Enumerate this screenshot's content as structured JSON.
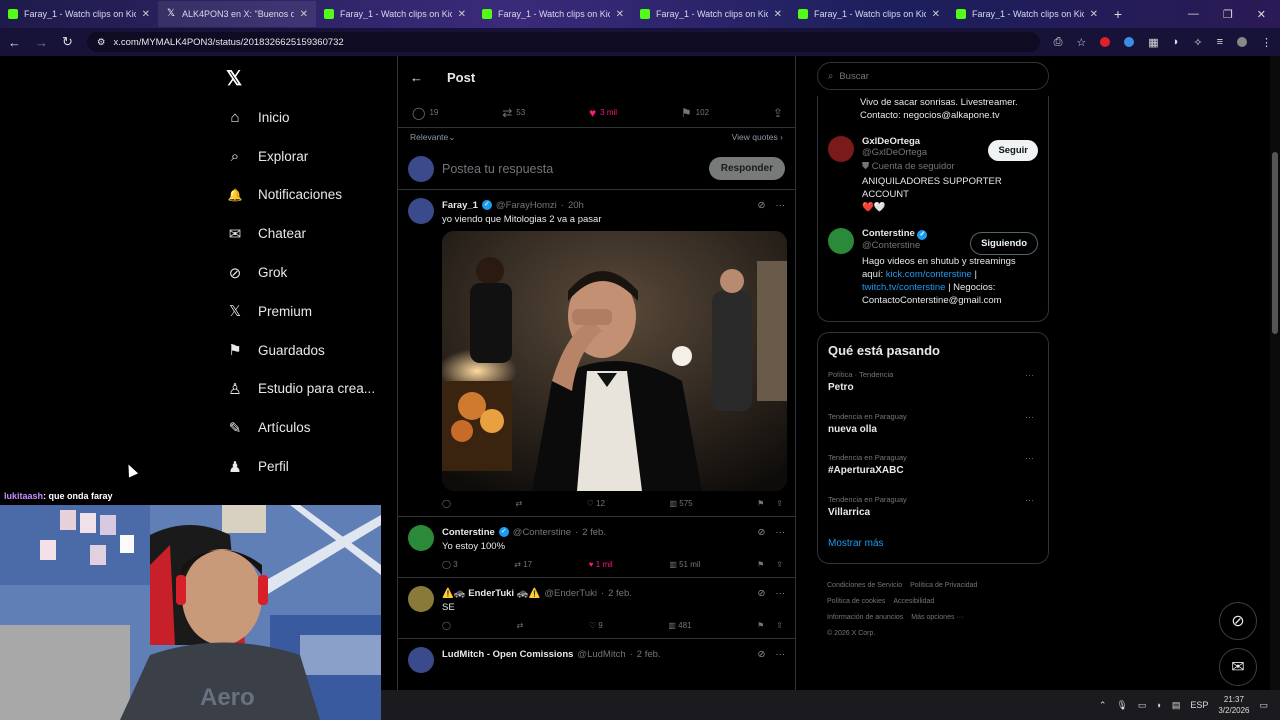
{
  "browser": {
    "tabs": [
      {
        "title": "Faray_1 - Watch clips on Kick",
        "favicon": "kick-icon"
      },
      {
        "title": "ALK4PON3 en X: \"Buenos d",
        "favicon": "x-icon"
      },
      {
        "title": "Faray_1 - Watch clips on Kick",
        "favicon": "kick-icon"
      },
      {
        "title": "Faray_1 - Watch clips on Kick",
        "favicon": "kick-icon"
      },
      {
        "title": "Faray_1 - Watch clips on Kick",
        "favicon": "kick-icon"
      },
      {
        "title": "Faray_1 - Watch clips on Kick",
        "favicon": "kick-icon"
      },
      {
        "title": "Faray_1 - Watch clips on Kick",
        "favicon": "kick-icon"
      }
    ],
    "url": "x.com/MYMALK4PON3/status/2018326625159360732"
  },
  "sidebar": {
    "items": [
      {
        "label": "Inicio",
        "icon": "⌂"
      },
      {
        "label": "Explorar",
        "icon": "⌕"
      },
      {
        "label": "Notificaciones",
        "icon": "🔔"
      },
      {
        "label": "Chatear",
        "icon": "✉"
      },
      {
        "label": "Grok",
        "icon": "⊘"
      },
      {
        "label": "Premium",
        "icon": "𝕏"
      },
      {
        "label": "Guardados",
        "icon": "⚑"
      },
      {
        "label": "Estudio para crea...",
        "icon": "♙"
      },
      {
        "label": "Artículos",
        "icon": "✎"
      },
      {
        "label": "Perfil",
        "icon": "♟"
      }
    ]
  },
  "post": {
    "header": "Post",
    "actions": {
      "replies": "19",
      "reposts": "53",
      "likes": "3 mil",
      "bookmarks": "102"
    },
    "sort_label": "Relevante",
    "view_quotes": "View quotes",
    "reply_placeholder": "Postea tu respuesta",
    "reply_button": "Responder"
  },
  "replies": [
    {
      "name": "Faray_1",
      "handle": "@FarayHomzi",
      "time": "20h",
      "text": "yo viendo que Mitologias 2 va a pasar",
      "likes": "12",
      "views": "575",
      "reposts": "",
      "comments": ""
    },
    {
      "name": "Conterstine",
      "handle": "@Conterstine",
      "time": "2 feb.",
      "text": "Yo estoy 100%",
      "comments": "3",
      "reposts": "17",
      "likes": "1 mil",
      "views": "51 mil"
    },
    {
      "name": "⚠️🚓 EnderTuki 🚓⚠️",
      "handle": "@EnderTuki",
      "time": "2 feb.",
      "text": "SE",
      "comments": "",
      "reposts": "",
      "likes": "9",
      "views": "481"
    },
    {
      "name": "LudMitch - Open Comissions",
      "handle": "@LudMitch",
      "time": "2 feb.",
      "text": ""
    }
  ],
  "right": {
    "search_placeholder": "Buscar",
    "top_bio": "Vivo de sacar sonrisas. Livestreamer. Contacto: negocios@alkapone.tv",
    "follow": [
      {
        "name": "GxlDeOrtega",
        "handle": "@GxlDeOrtega",
        "badge": "Cuenta de seguidor",
        "bio": "ANIQUILADORES SUPPORTER ACCOUNT",
        "hearts": "❤️🤍",
        "button": "Seguir"
      },
      {
        "name": "Conterstine",
        "handle": "@Conterstine",
        "bio_prefix": "Hago videos en shutub y streamings aquí:",
        "link1": "kick.com/conterstine",
        "sep": "|",
        "link2": "twitch.tv/conterstine",
        "bio_suffix": "| Negocios: ContactoConterstine@gmail.com",
        "button": "Siguiendo"
      }
    ],
    "trends_title": "Qué está pasando",
    "trends": [
      {
        "category": "Política · Tendencia",
        "name": "Petro"
      },
      {
        "category": "Tendencia en Paraguay",
        "name": "nueva olla"
      },
      {
        "category": "Tendencia en Paraguay",
        "name": "#AperturaXABC"
      },
      {
        "category": "Tendencia en Paraguay",
        "name": "Villarrica"
      }
    ],
    "show_more": "Mostrar más",
    "footer": [
      "Condiciones de Servicio",
      "Política de Privacidad",
      "Política de cookies",
      "Accesibilidad",
      "Información de anuncios",
      "Más opciones ···",
      "© 2026 X Corp."
    ]
  },
  "stream": {
    "chat_user": "lukitaash",
    "chat_msg": ": que onda faray"
  },
  "taskbar": {
    "lang": "ESP",
    "time": "21:37",
    "date": "3/2/2026"
  }
}
